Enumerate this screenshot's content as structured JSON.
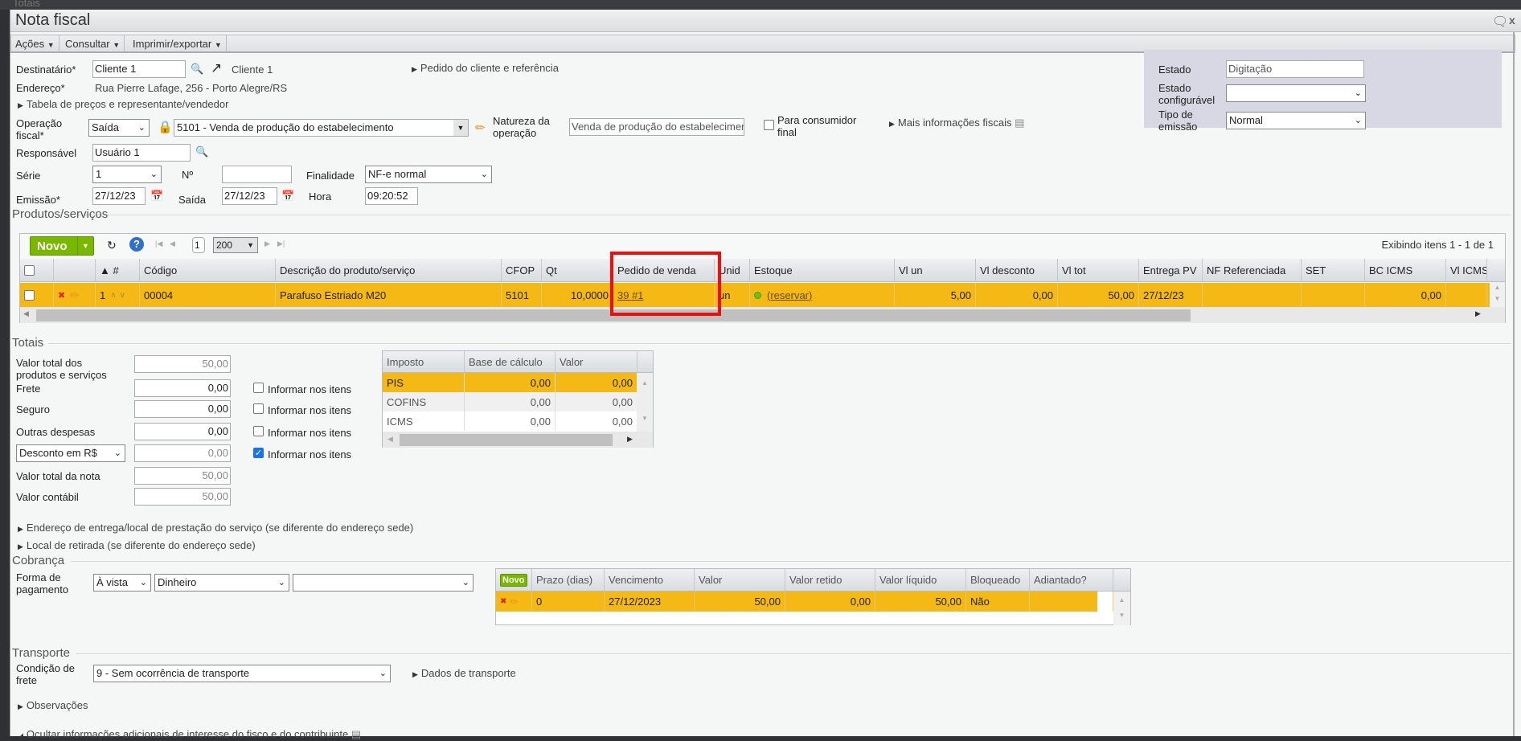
{
  "background": {
    "text": "Totais"
  },
  "window": {
    "title": "Nota fiscal"
  },
  "menu": [
    {
      "label": "Ações"
    },
    {
      "label": "Consultar"
    },
    {
      "label": "Imprimir/exportar"
    }
  ],
  "header": {
    "destinatario_label": "Destinatário*",
    "destinatario_value": "Cliente 1",
    "destinatario_link": "Cliente 1",
    "pedido_cliente": "Pedido do cliente e referência",
    "endereco_label": "Endereço*",
    "endereco_value": "Rua Pierre Lafage, 256 - Porto Alegre/RS",
    "tabela_precos": "Tabela de preços e representante/vendedor",
    "operacao_label1": "Operação",
    "operacao_label2": "fiscal*",
    "operacao_tipo": "Saída",
    "operacao_value": "5101 - Venda de produção do estabelecimento",
    "natureza_label1": "Natureza da",
    "natureza_label2": "operação",
    "natureza_value": "Venda de produção do estabelecimento",
    "consumidor_label1": "Para consumidor",
    "consumidor_label2": "final",
    "mais_info": "Mais informações fiscais",
    "responsavel_label": "Responsável",
    "responsavel_value": "Usuário 1",
    "serie_label": "Série",
    "serie_value": "1",
    "numero_label": "Nº",
    "numero_value": "",
    "finalidade_label": "Finalidade",
    "finalidade_value": "NF-e normal",
    "emissao_label": "Emissão*",
    "emissao_value": "27/12/23",
    "saida_label": "Saída",
    "saida_value": "27/12/23",
    "hora_label": "Hora",
    "hora_value": "09:20:52"
  },
  "status_panel": {
    "estado_label": "Estado",
    "estado_value": "Digitação",
    "config_label1": "Estado",
    "config_label2": "configurável",
    "config_value": "",
    "tipo_label1": "Tipo de",
    "tipo_label2": "emissão",
    "tipo_value": "Normal"
  },
  "products": {
    "section": "Produtos/serviços",
    "new_label": "Novo",
    "page": "1",
    "page_size": "200",
    "showing": "Exibindo itens 1 - 1 de 1",
    "columns": [
      "",
      "",
      "▲ #",
      "Código",
      "Descrição do produto/serviço",
      "CFOP",
      "Qt",
      "Pedido de venda",
      "Unid",
      "Estoque",
      "Vl un",
      "Vl desconto",
      "Vl tot",
      "Entrega PV",
      "NF Referenciada",
      "SET",
      "BC ICMS",
      "Vl ICMS"
    ],
    "rows": [
      {
        "num": "1",
        "codigo": "00004",
        "descricao": "Parafuso Estriado M20",
        "cfop": "5101",
        "qt": "10,0000",
        "pedido": "39 #1",
        "unid": "un",
        "estoque": "(reservar)",
        "vl_un": "5,00",
        "vl_desconto": "0,00",
        "vl_tot": "50,00",
        "entrega": "27/12/23",
        "nf_ref": "",
        "set": "",
        "bc_icms": "0,00",
        "vl_icms": ""
      }
    ]
  },
  "totais": {
    "section": "Totais",
    "fields": [
      {
        "label1": "Valor total dos",
        "label2": "produtos e serviços",
        "value": "50,00"
      },
      {
        "label1": "Frete",
        "value": "0,00",
        "check": "Informar nos itens",
        "checked": false
      },
      {
        "label1": "Seguro",
        "value": "0,00",
        "check": "Informar nos itens",
        "checked": false
      },
      {
        "label1": "Outras despesas",
        "value": "0,00",
        "check": "Informar nos itens",
        "checked": false
      },
      {
        "select": "Desconto em R$",
        "value": "0,00",
        "check": "Informar nos itens",
        "checked": true
      },
      {
        "label1": "Valor total da nota",
        "value": "50,00"
      },
      {
        "label1": "Valor contábil",
        "value": "50,00"
      }
    ],
    "tax_columns": [
      "Imposto",
      "Base de cálculo",
      "Valor"
    ],
    "tax_rows": [
      [
        "PIS",
        "0,00",
        "0,00"
      ],
      [
        "COFINS",
        "0,00",
        "0,00"
      ],
      [
        "ICMS",
        "0,00",
        "0,00"
      ]
    ],
    "entrega": "Endereço de entrega/local de prestação do serviço (se diferente do endereço sede)",
    "retirada": "Local de retirada (se diferente do endereço sede)"
  },
  "cobranca": {
    "section": "Cobrança",
    "forma_label1": "Forma de",
    "forma_label2": "pagamento",
    "forma_value": "À vista",
    "meio_value": "Dinheiro",
    "extra_value": "",
    "new_label": "Novo",
    "columns": [
      "",
      "Prazo (dias)",
      "Vencimento",
      "Valor",
      "Valor retido",
      "Valor líquido",
      "Bloqueado",
      "Adiantado?"
    ],
    "rows": [
      [
        "",
        "0",
        "27/12/2023",
        "50,00",
        "0,00",
        "50,00",
        "Não",
        ""
      ]
    ]
  },
  "transporte": {
    "section": "Transporte",
    "condicao_label1": "Condição de",
    "condicao_label2": "frete",
    "condicao_value": "9 - Sem ocorrência de transporte",
    "dados": "Dados de transporte"
  },
  "observacoes": "Observações",
  "ocultar": "Ocultar informações adicionais de interesse do fisco e do contribuinte",
  "colors": {
    "highlight": "#f4b914",
    "accent_green": "#7ab800",
    "panel": "#d8d8e4",
    "annotation": "#f20d0d"
  }
}
